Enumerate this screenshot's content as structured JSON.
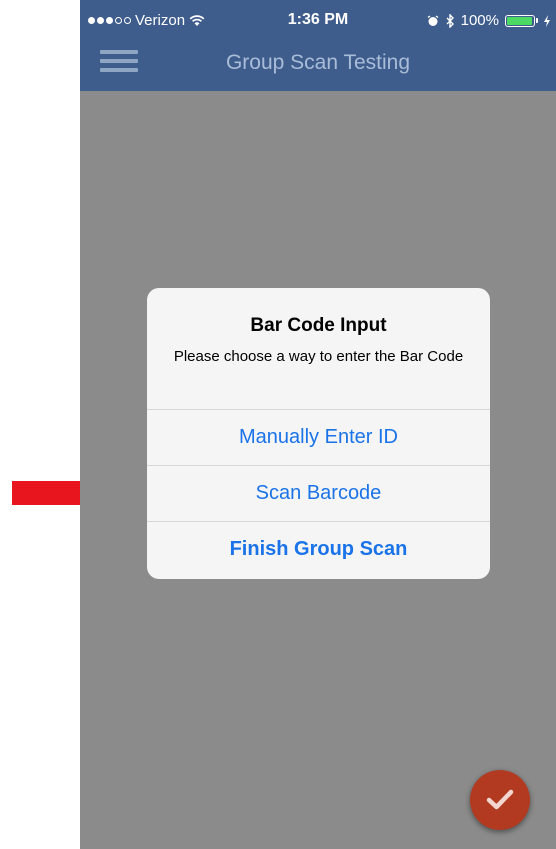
{
  "status_bar": {
    "carrier": "Verizon",
    "time": "1:36 PM",
    "battery_text": "100%",
    "battery_level": 1.0,
    "signal_bars_filled": 3,
    "signal_bars_total": 5
  },
  "nav": {
    "title": "Group Scan Testing",
    "menu_icon": "hamburger-menu-icon"
  },
  "dialog": {
    "title": "Bar Code Input",
    "message": "Please choose a way to enter the Bar Code",
    "actions": [
      {
        "label": "Manually Enter ID",
        "bold": false
      },
      {
        "label": "Scan Barcode",
        "bold": false
      },
      {
        "label": "Finish Group Scan",
        "bold": true
      }
    ]
  },
  "fab": {
    "icon": "checkmark-icon"
  },
  "annotation": {
    "icon": "red-arrow-icon",
    "points_to": "Scan Barcode"
  },
  "colors": {
    "navbar": "#3f5d8c",
    "overlay": "#8b8b8b",
    "dialog_bg": "#f5f5f5",
    "action_blue": "#1a73e8",
    "fab_red": "#b23a20",
    "arrow_red": "#e8141e",
    "battery_green": "#4cd964"
  }
}
